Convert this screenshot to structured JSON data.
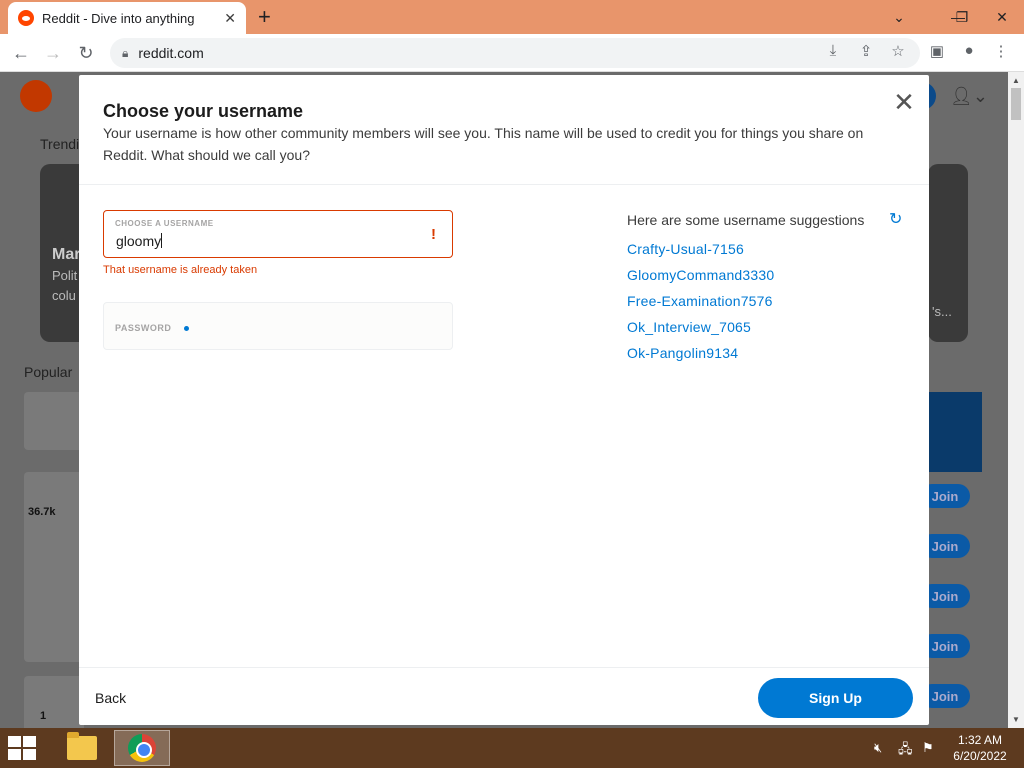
{
  "browser": {
    "tab_title": "Reddit - Dive into anything",
    "tab_close": "✕",
    "new_tab": "+",
    "url": "reddit.com",
    "win_dropdown": "⌄",
    "win_minimize": "—",
    "win_maximize": "❐",
    "win_close": "✕"
  },
  "background": {
    "trending": "Trendi",
    "card_title": "Mar",
    "card_line1": "Polit",
    "card_line2": "colu",
    "card_right_text": "'s...",
    "popular": "Popular",
    "votes": "36.7k",
    "votes2": "1",
    "join_label": "Join"
  },
  "modal": {
    "title": "Choose your username",
    "description": "Your username is how other community members will see you. This name will be used to credit you for things you share on Reddit. What should we call you?",
    "close": "✕",
    "username_label": "CHOOSE A USERNAME",
    "username_value": "gloomy",
    "username_error_mark": "!",
    "username_error": "That username is already taken",
    "password_label": "PASSWORD",
    "suggestions_heading": "Here are some username suggestions",
    "suggestions": [
      "Crafty-Usual-7156",
      "GloomyCommand3330",
      "Free-Examination7576",
      "Ok_Interview_7065",
      "Ok-Pangolin9134"
    ],
    "back_label": "Back",
    "signup_label": "Sign Up"
  },
  "taskbar": {
    "time": "1:32 AM",
    "date": "6/20/2022"
  },
  "colors": {
    "accent": "#0079d3",
    "error": "#d93a00",
    "tabstrip": "#e8956b",
    "taskbar": "#5d3a1f"
  }
}
